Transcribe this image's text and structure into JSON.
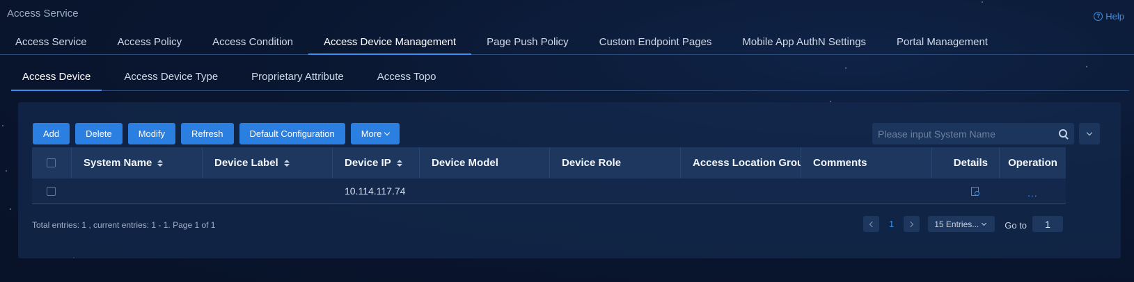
{
  "app": {
    "title": "Access Service",
    "help_label": "Help"
  },
  "main_tabs": [
    {
      "label": "Access Service"
    },
    {
      "label": "Access Policy"
    },
    {
      "label": "Access Condition"
    },
    {
      "label": "Access Device Management",
      "active": true
    },
    {
      "label": "Page Push Policy"
    },
    {
      "label": "Custom Endpoint Pages"
    },
    {
      "label": "Mobile App AuthN Settings"
    },
    {
      "label": "Portal Management"
    }
  ],
  "sub_tabs": [
    {
      "label": "Access Device",
      "active": true
    },
    {
      "label": "Access Device Type"
    },
    {
      "label": "Proprietary Attribute"
    },
    {
      "label": "Access Topo"
    }
  ],
  "toolbar": {
    "add": "Add",
    "delete": "Delete",
    "modify": "Modify",
    "refresh": "Refresh",
    "default_config": "Default Configuration",
    "more": "More"
  },
  "search": {
    "placeholder": "Please input System Name",
    "value": ""
  },
  "table": {
    "columns": {
      "system_name": "System Name",
      "device_label": "Device Label",
      "device_ip": "Device IP",
      "device_model": "Device Model",
      "device_role": "Device Role",
      "access_location_group": "Access Location Group",
      "comments": "Comments",
      "details": "Details",
      "operation": "Operation"
    },
    "rows": [
      {
        "system_name": "",
        "device_label": "",
        "device_ip": "10.114.117.74",
        "device_model": "",
        "device_role": "",
        "access_location_group": "",
        "comments": "",
        "operation": "..."
      }
    ]
  },
  "footer": {
    "summary": "Total entries: 1 , current entries: 1 - 1. Page 1 of 1",
    "current_page": "1",
    "page_size": "15 Entries...",
    "goto_label": "Go to",
    "goto_value": "1"
  },
  "colors": {
    "accent": "#2a7fe0",
    "link": "#3d8fe8",
    "background": "#0a1731"
  }
}
